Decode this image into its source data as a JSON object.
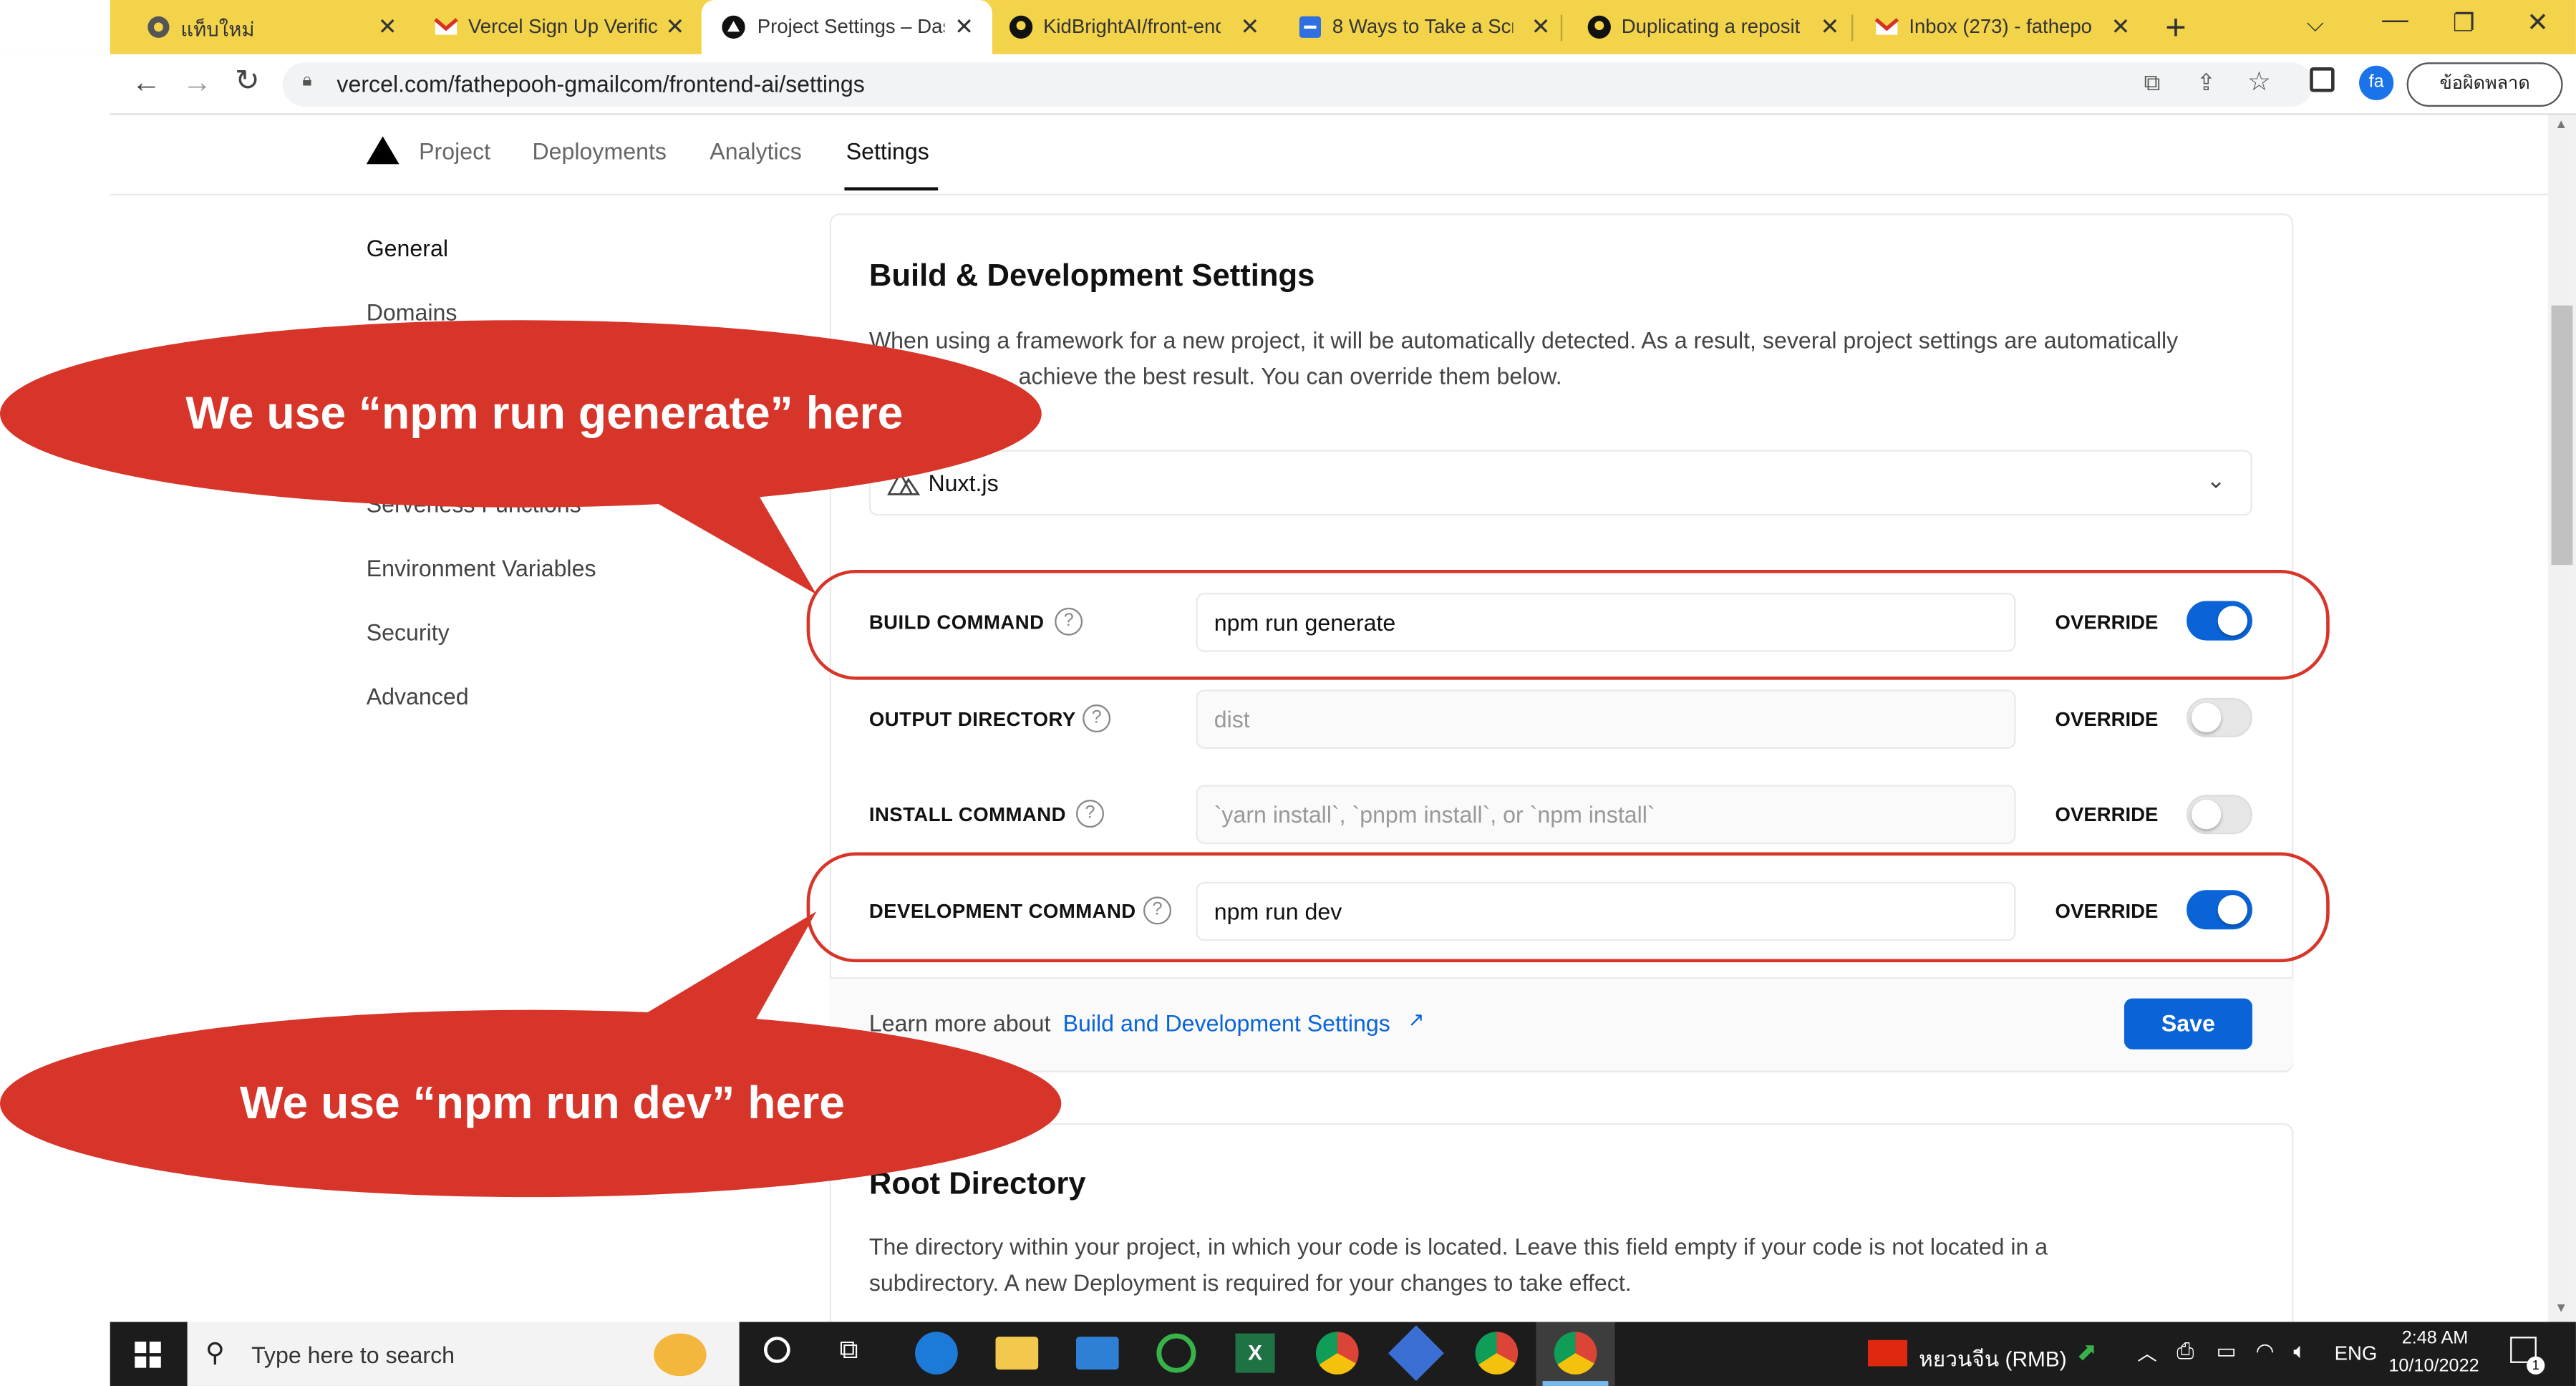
{
  "browser": {
    "tabs": [
      {
        "label": "แท็บใหม่",
        "icon": "chrome-icon"
      },
      {
        "label": "Vercel Sign Up Verific",
        "icon": "gmail-icon"
      },
      {
        "label": "Project Settings – Das",
        "icon": "vercel-icon",
        "active": true
      },
      {
        "label": "KidBrightAI/front-end",
        "icon": "github-icon"
      },
      {
        "label": "8 Ways to Take a Scre",
        "icon": "bookmark-icon"
      },
      {
        "label": "Duplicating a reposit",
        "icon": "github-icon"
      },
      {
        "label": "Inbox (273) - fathepo",
        "icon": "gmail-icon"
      }
    ],
    "url": "vercel.com/fathepooh-gmailcom/frontend-ai/settings",
    "profile_initials": "fa",
    "error_button": "ข้อผิดพลาด"
  },
  "vercel_nav": {
    "items": [
      "Project",
      "Deployments",
      "Analytics",
      "Settings"
    ],
    "active": "Settings"
  },
  "sidebar": {
    "items": [
      "General",
      "Domains",
      "Serverless Functions",
      "Environment Variables",
      "Security",
      "Advanced"
    ]
  },
  "build_card": {
    "title": "Build & Development Settings",
    "desc_line1": "When using a framework for a new project, it will be automatically detected. As a result, several project settings are automatically",
    "desc_line2": "achieve the best result. You can override them below.",
    "framework_value": "Nuxt.js",
    "rows": [
      {
        "label": "BUILD COMMAND",
        "value": "npm run generate",
        "override": true,
        "placeholder": false
      },
      {
        "label": "OUTPUT DIRECTORY",
        "value": "dist",
        "override": false,
        "placeholder": true
      },
      {
        "label": "INSTALL COMMAND",
        "value": "`yarn install`, `pnpm install`, or `npm install`",
        "override": false,
        "placeholder": true
      },
      {
        "label": "DEVELOPMENT COMMAND",
        "value": "npm run dev",
        "override": true,
        "placeholder": false
      }
    ],
    "override_label": "OVERRIDE",
    "footer_text": "Learn more about ",
    "footer_link": "Build and Development Settings",
    "save": "Save"
  },
  "root_card": {
    "title": "Root Directory",
    "desc_line1": "The directory within your project, in which your code is located. Leave this field empty if your code is not located in a",
    "desc_line2": "subdirectory. A new Deployment is required for your changes to take effect."
  },
  "callouts": {
    "top": "We use “npm run generate” here",
    "bottom": "We use “npm run dev” here"
  },
  "taskbar": {
    "search_placeholder": "Type here to search",
    "currency": "หยวนจีน (RMB)",
    "lang": "ENG",
    "time": "2:48 AM",
    "date": "10/10/2022",
    "notif_count": "1"
  },
  "colors": {
    "callout": "#d8352a",
    "accent": "#0a64d8",
    "tabbar": "#f3d34a"
  }
}
